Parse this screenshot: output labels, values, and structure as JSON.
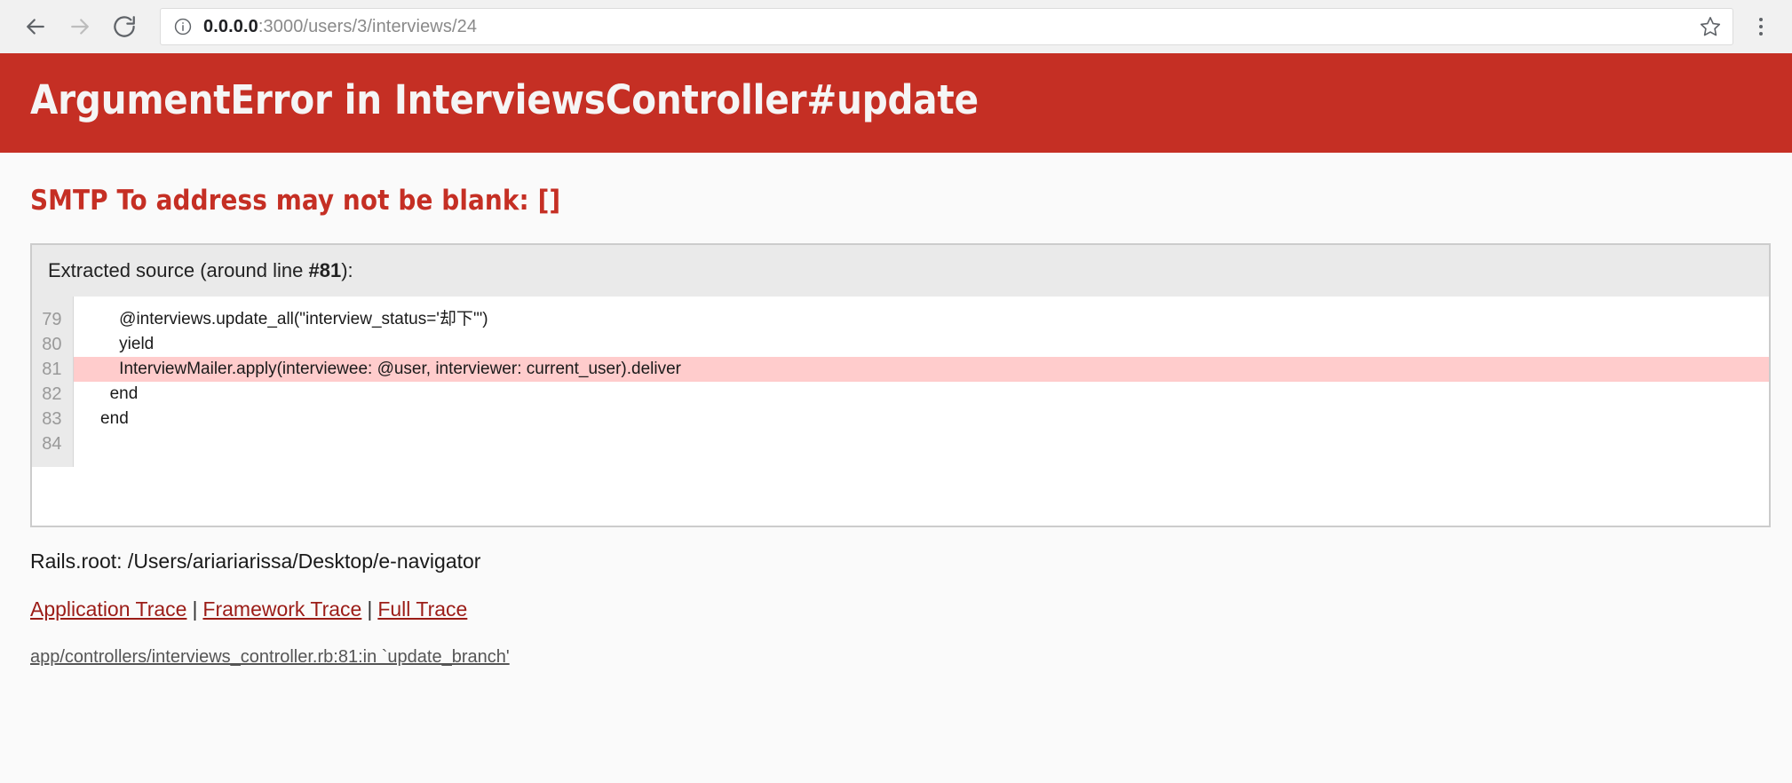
{
  "browser": {
    "back_label": "Back",
    "forward_label": "Forward",
    "reload_label": "Reload",
    "site_info_icon": "info-circle-icon",
    "bookmark_icon": "star-icon",
    "menu_icon": "three-dots-menu-icon",
    "url": {
      "host": "0.0.0.0",
      "rest": ":3000/users/3/interviews/24",
      "full": "0.0.0.0:3000/users/3/interviews/24"
    }
  },
  "error": {
    "title": "ArgumentError in InterviewsController#update",
    "message": "SMTP To address may not be blank: []",
    "banner_color": "#c52f24",
    "message_color": "#c52f24"
  },
  "extracted_source": {
    "header_prefix": "Extracted source (around line ",
    "header_line": "#81",
    "header_suffix": "):",
    "highlight_color": "#ffcccc",
    "lines": [
      {
        "number": "79",
        "code": "      @interviews.update_all(\"interview_status='却下'\")",
        "highlighted": false
      },
      {
        "number": "80",
        "code": "      yield",
        "highlighted": false
      },
      {
        "number": "81",
        "code": "      InterviewMailer.apply(interviewee: @user, interviewer: current_user).deliver",
        "highlighted": true
      },
      {
        "number": "82",
        "code": "    end",
        "highlighted": false
      },
      {
        "number": "83",
        "code": "  end",
        "highlighted": false
      },
      {
        "number": "84",
        "code": "",
        "highlighted": false
      }
    ]
  },
  "rails_root": {
    "label": "Rails.root: /Users/ariariarissa/Desktop/e-navigator"
  },
  "traces": {
    "application": "Application Trace",
    "framework": "Framework Trace",
    "full": "Full Trace",
    "separator": "|",
    "entries": [
      "app/controllers/interviews_controller.rb:81:in `update_branch'"
    ]
  }
}
